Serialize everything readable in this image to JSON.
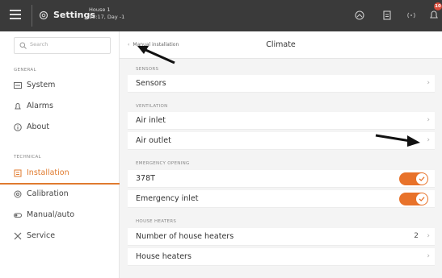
{
  "topbar": {
    "title": "Settings",
    "house_name": "House 1",
    "house_time": "13:17, Day -1",
    "notification_count": "10"
  },
  "sidebar": {
    "search_placeholder": "Search",
    "general_label": "GENERAL",
    "technical_label": "TECHNICAL",
    "items": [
      {
        "label": "System",
        "icon": "system-icon"
      },
      {
        "label": "Alarms",
        "icon": "bell-icon"
      },
      {
        "label": "About",
        "icon": "info-icon"
      },
      {
        "label": "Installation",
        "icon": "installation-icon",
        "active": true
      },
      {
        "label": "Calibration",
        "icon": "calibration-icon"
      },
      {
        "label": "Manual/auto",
        "icon": "toggle-icon"
      },
      {
        "label": "Service",
        "icon": "tools-icon"
      }
    ]
  },
  "header": {
    "back_label": "Manual installation",
    "title": "Climate"
  },
  "groups": {
    "sensors": {
      "label": "SENSORS",
      "rows": [
        "Sensors"
      ]
    },
    "ventilation": {
      "label": "VENTILATION",
      "rows": [
        "Air inlet",
        "Air outlet"
      ]
    },
    "emergency": {
      "label": "EMERGENCY OPENING",
      "rows": [
        "378T",
        "Emergency inlet"
      ]
    },
    "heaters": {
      "label": "HOUSE HEATERS",
      "rows": [
        "Number of house heaters",
        "House heaters"
      ],
      "heater_count": "2"
    }
  },
  "colors": {
    "accent": "#e8722a",
    "topbar": "#3a3a3a"
  }
}
